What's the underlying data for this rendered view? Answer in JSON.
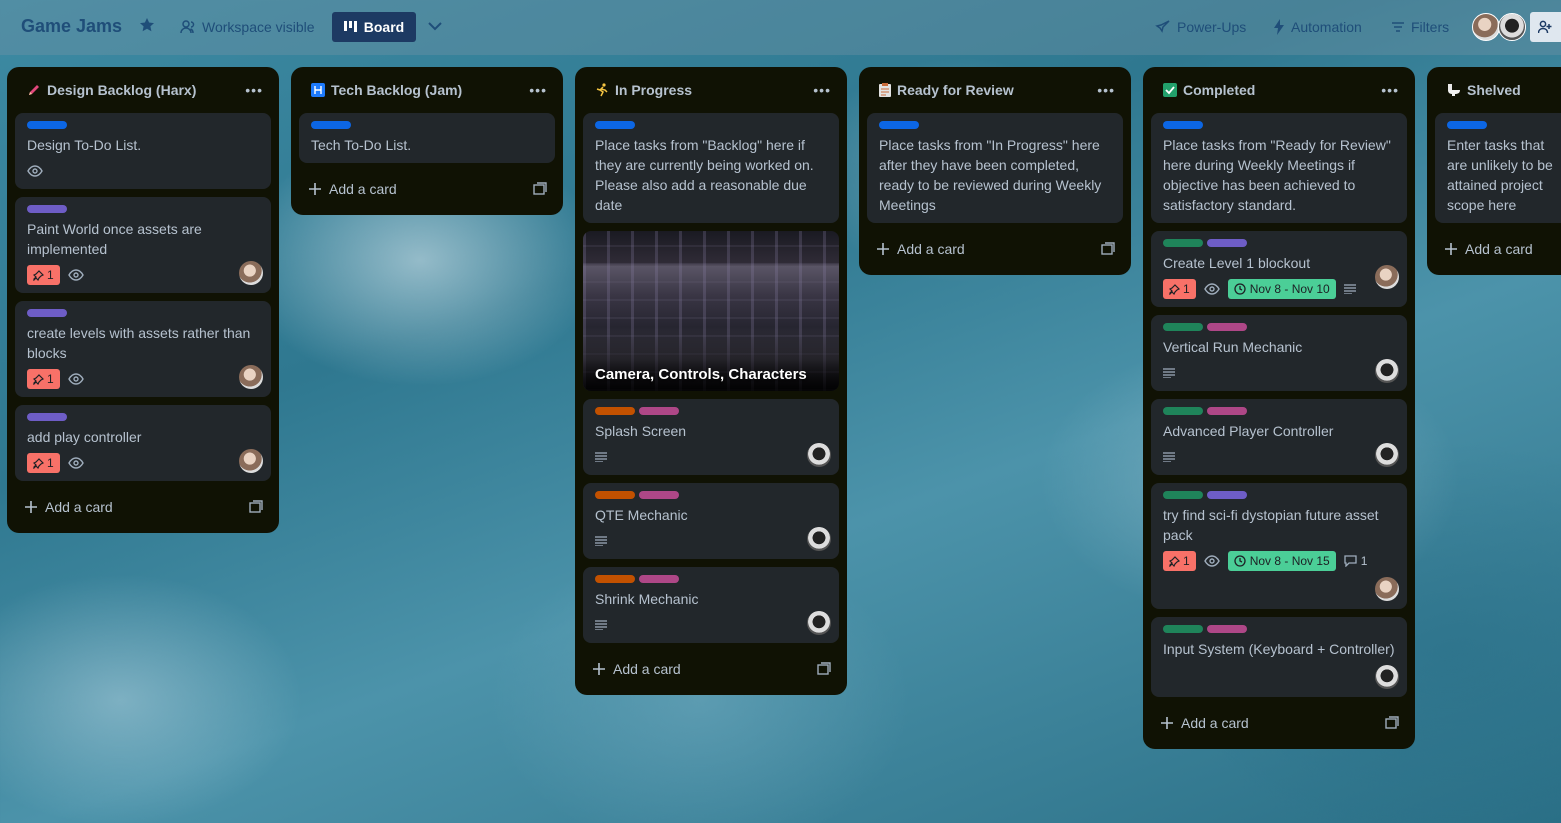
{
  "header": {
    "board_title": "Game Jams",
    "visibility": "Workspace visible",
    "view": "Board",
    "power_ups": "Power-Ups",
    "automation": "Automation",
    "filters": "Filters"
  },
  "colors": {
    "blue": "#0c66e4",
    "purple": "#6e5dc6",
    "green": "#1f845a",
    "pink": "#ae4787",
    "orange": "#c25100",
    "red": "#f87168",
    "date_green": "#4bce97"
  },
  "lists": [
    {
      "title": "Design Backlog (Harx)",
      "icon": "pencil-icon",
      "add": "Add a card",
      "cards": [
        {
          "title": "Design To-Do List."
        },
        {
          "title": "Paint World once assets are implemented",
          "votes": "1"
        },
        {
          "title": "create levels with assets rather than blocks",
          "votes": "1"
        },
        {
          "title": "add play controller",
          "votes": "1"
        }
      ]
    },
    {
      "title": "Tech Backlog (Jam)",
      "icon": "circuit-icon",
      "add": "Add a card",
      "cards": [
        {
          "title": "Tech To-Do List."
        }
      ]
    },
    {
      "title": "In Progress",
      "icon": "runner-icon",
      "add": "Add a card",
      "cards": [
        {
          "title": "Place tasks from \"Backlog\" here if they are currently being worked on. Please also add a reasonable due date"
        },
        {
          "title": "Camera, Controls, Characters"
        },
        {
          "title": "Splash Screen"
        },
        {
          "title": "QTE Mechanic"
        },
        {
          "title": "Shrink Mechanic"
        }
      ]
    },
    {
      "title": "Ready for Review",
      "icon": "clipboard-icon",
      "add": "Add a card",
      "cards": [
        {
          "title": "Place tasks from \"In Progress\" here after they have been completed, ready to be reviewed during Weekly Meetings"
        }
      ]
    },
    {
      "title": "Completed",
      "icon": "checkbox-icon",
      "add": "Add a card",
      "cards": [
        {
          "title": "Place tasks from \"Ready for Review\" here during Weekly Meetings if objective has been achieved to satisfactory standard."
        },
        {
          "title": "Create Level 1 blockout",
          "votes": "1",
          "date": "Nov 8 - Nov 10"
        },
        {
          "title": "Vertical Run Mechanic"
        },
        {
          "title": "Advanced Player Controller"
        },
        {
          "title": "try find sci-fi dystopian future asset pack",
          "votes": "1",
          "date": "Nov 8 - Nov 15",
          "comments": "1"
        },
        {
          "title": "Input System (Keyboard + Controller)"
        }
      ]
    },
    {
      "title": "Shelved",
      "icon": "toilet-icon",
      "add": "Add a card",
      "cards": [
        {
          "title": "Enter tasks that are unlikely to be attained project scope here"
        }
      ]
    }
  ]
}
